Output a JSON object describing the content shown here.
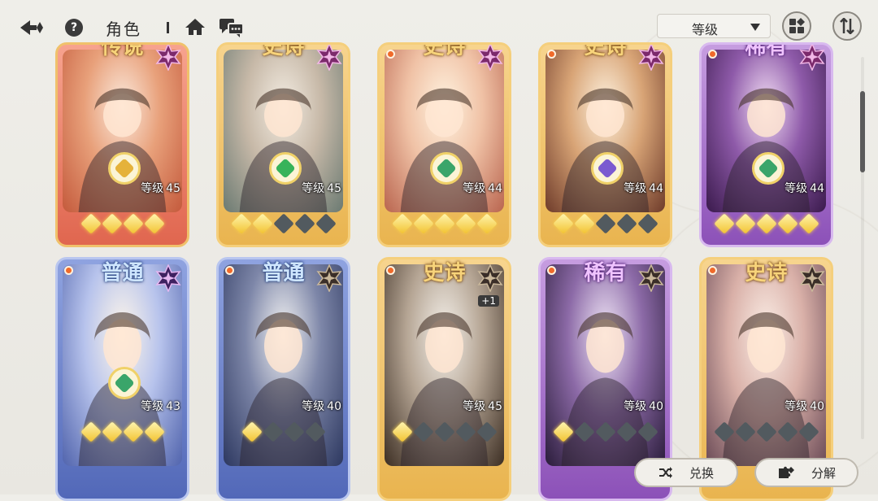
{
  "topbar": {
    "title": "角色",
    "sort_select": {
      "value": "等级"
    }
  },
  "cards": [
    {
      "rarity": "传说",
      "rarity_class": "r-legend",
      "level_label": "等级",
      "level": "45",
      "stars_on": 4,
      "stars_off": 0,
      "badge_icon": "pink-star-icon",
      "emblem_color": "#e5b23a",
      "has_dot": false,
      "plus": null
    },
    {
      "rarity": "史诗",
      "rarity_class": "r-epic",
      "level_label": "等级",
      "level": "45",
      "stars_on": 2,
      "stars_off": 3,
      "badge_icon": "pink-star-icon",
      "emblem_color": "#37b35a",
      "has_dot": false,
      "plus": null
    },
    {
      "rarity": "史诗",
      "rarity_class": "r-epic",
      "level_label": "等级",
      "level": "44",
      "stars_on": 5,
      "stars_off": 0,
      "badge_icon": "pink-star-icon",
      "emblem_color": "#3aa56a",
      "has_dot": true,
      "plus": null
    },
    {
      "rarity": "史诗",
      "rarity_class": "r-epic",
      "level_label": "等级",
      "level": "44",
      "stars_on": 2,
      "stars_off": 3,
      "badge_icon": "pink-star-icon",
      "emblem_color": "#7a5ad0",
      "has_dot": true,
      "plus": null
    },
    {
      "rarity": "稀有",
      "rarity_class": "r-rare",
      "level_label": "等级",
      "level": "44",
      "stars_on": 5,
      "stars_off": 0,
      "badge_icon": "pink-star-icon",
      "emblem_color": "#3aa56a",
      "has_dot": true,
      "plus": null
    },
    {
      "rarity": "普通",
      "rarity_class": "r-normal",
      "level_label": "等级",
      "level": "43",
      "stars_on": 4,
      "stars_off": 0,
      "badge_icon": "purple-star-icon",
      "emblem_color": "#3aa56a",
      "has_dot": true,
      "plus": null
    },
    {
      "rarity": "普通",
      "rarity_class": "r-normal",
      "level_label": "等级",
      "level": "40",
      "stars_on": 1,
      "stars_off": 3,
      "badge_icon": "dark-star-icon",
      "emblem_color": null,
      "has_dot": true,
      "plus": null
    },
    {
      "rarity": "史诗",
      "rarity_class": "r-epic",
      "level_label": "等级",
      "level": "45",
      "stars_on": 1,
      "stars_off": 4,
      "badge_icon": "dark-star-icon",
      "emblem_color": null,
      "has_dot": true,
      "plus": "+1"
    },
    {
      "rarity": "稀有",
      "rarity_class": "r-rare",
      "level_label": "等级",
      "level": "40",
      "stars_on": 1,
      "stars_off": 4,
      "badge_icon": "dark-star-icon",
      "emblem_color": null,
      "has_dot": true,
      "plus": null
    },
    {
      "rarity": "史诗",
      "rarity_class": "r-epic",
      "level_label": "等级",
      "level": "40",
      "stars_on": 0,
      "stars_off": 5,
      "badge_icon": "dark-star-icon",
      "emblem_color": null,
      "has_dot": true,
      "plus": null
    }
  ],
  "bottom": {
    "exchange_label": "兑换",
    "decompose_label": "分解"
  },
  "colors": {
    "orange_dot": "#f06a2a",
    "gold_star": "#f2c230"
  }
}
